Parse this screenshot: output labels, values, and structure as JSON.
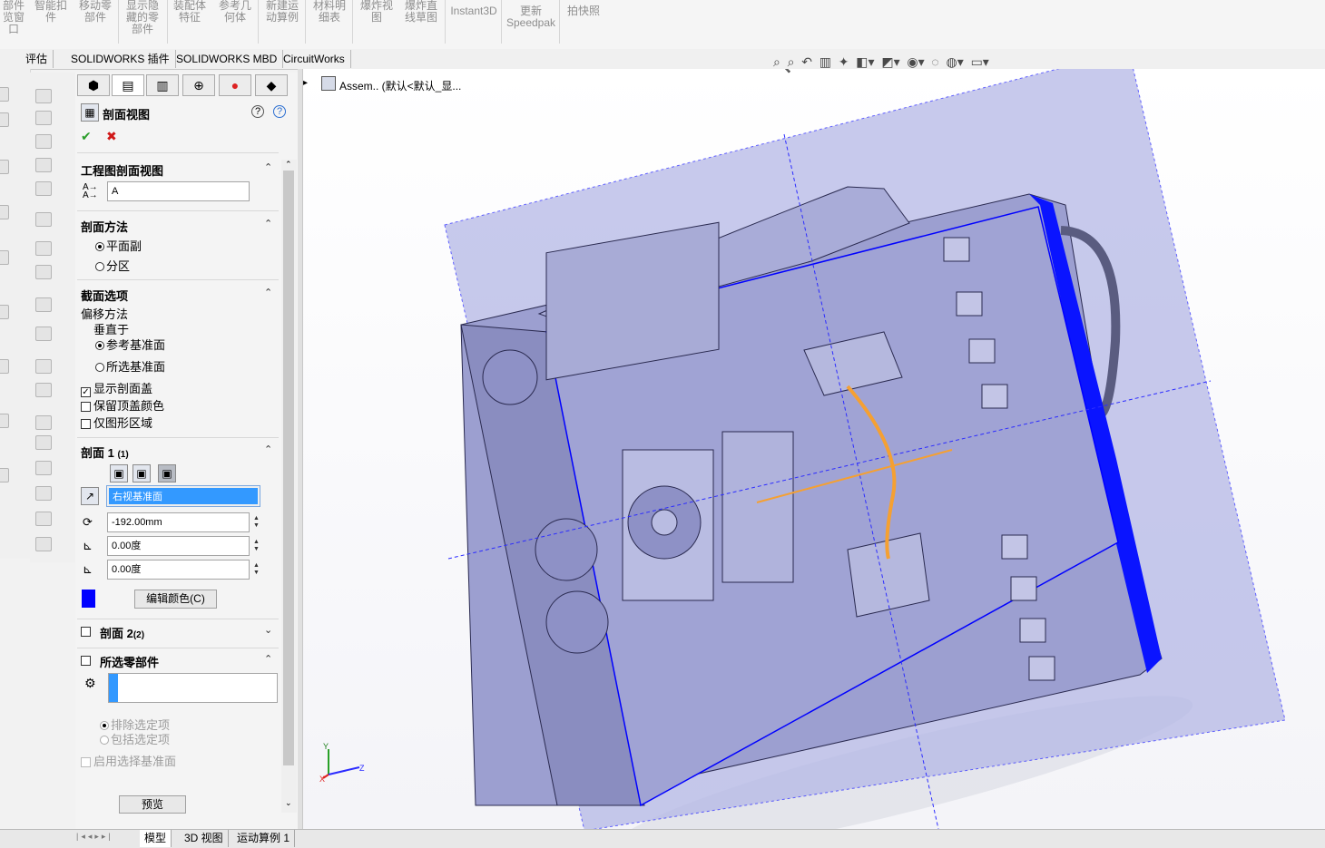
{
  "ribbon": {
    "items": [
      {
        "label": "部件\n览窗\n口",
        "icon": "component-preview-icon"
      },
      {
        "label": "智能扣\n件",
        "icon": "smart-fasteners-icon"
      },
      {
        "label": "移动零\n部件",
        "icon": "move-component-icon"
      },
      {
        "label": "显示隐\n藏的零\n部件",
        "icon": "show-hidden-icon"
      },
      {
        "label": "装配体\n特征",
        "icon": "assembly-features-icon"
      },
      {
        "label": "参考几\n何体",
        "icon": "reference-geometry-icon"
      },
      {
        "label": "新建运\n动算例",
        "icon": "new-motion-study-icon"
      },
      {
        "label": "材料明\n细表",
        "icon": "bom-icon"
      },
      {
        "label": "爆炸视\n图",
        "icon": "exploded-view-icon"
      },
      {
        "label": "爆炸直\n线草图",
        "icon": "explode-line-sketch-icon"
      },
      {
        "label": "Instant3D",
        "icon": "instant3d-icon"
      },
      {
        "label": "更新\nSpeedpak",
        "icon": "update-speedpak-icon"
      },
      {
        "label": "拍快照",
        "icon": "snapshot-icon"
      }
    ]
  },
  "tabs": [
    "评估",
    "SOLIDWORKS 插件",
    "SOLIDWORKS MBD",
    "CircuitWorks"
  ],
  "tree": {
    "label": "Assem.. (默认<默认_显..."
  },
  "pm": {
    "title": "剖面视图",
    "ok_icon": "✔",
    "cancel_icon": "✖",
    "help": "?",
    "sections": {
      "drawing": {
        "title": "工程图剖面视图",
        "label_value": "A"
      },
      "method": {
        "title": "剖面方法",
        "opt1": "平面副",
        "opt2": "分区",
        "selected": "平面副"
      },
      "options": {
        "title": "截面选项",
        "offset_method": "偏移方法",
        "perpendicular": "垂直于",
        "ref_plane": "参考基准面",
        "sel_plane": "所选基准面",
        "show_cap": "显示剖面盖",
        "keep_cap_color": "保留顶盖颜色",
        "graphics_only": "仅图形区域"
      },
      "section1": {
        "title": "剖面 1",
        "count": "(1)",
        "plane": "右视基准面",
        "distance": "-192.00mm",
        "angle_x": "0.00度",
        "angle_y": "0.00度",
        "edit_color": "编辑颜色(C)",
        "color": "#0000ff"
      },
      "section2": {
        "title": "剖面 2",
        "count": "(2)"
      },
      "selected_parts": {
        "title": "所选零部件",
        "exclude": "排除选定项",
        "include": "包括选定项",
        "enable_plane": "启用选择基准面"
      },
      "preview": "预览"
    }
  },
  "status_tabs": [
    "模型",
    "3D 视图",
    "运动算例 1"
  ],
  "colors": {
    "section_plane": "#b5b8e6",
    "section_edge": "#0000ff",
    "model_body": "#9c9fd0",
    "triad": "#f5a032",
    "selection": "#3399ff"
  }
}
